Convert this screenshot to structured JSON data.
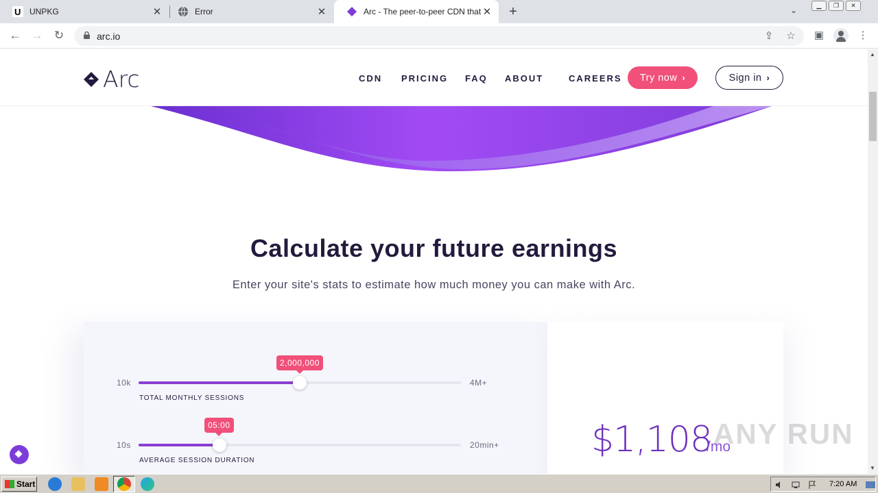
{
  "browser": {
    "tabs": [
      {
        "title": "UNPKG"
      },
      {
        "title": "Error"
      },
      {
        "title": "Arc - The peer-to-peer CDN that pays"
      }
    ],
    "url": "arc.io"
  },
  "site": {
    "logo_text": "Arc",
    "nav": [
      "CDN",
      "PRICING",
      "FAQ",
      "ABOUT",
      "CAREERS"
    ],
    "try_label": "Try now",
    "sign_label": "Sign in",
    "headline": "Calculate your future earnings",
    "subhead": "Enter your site's stats to estimate how much money you can make with Arc.",
    "sliders": [
      {
        "min": "10k",
        "max": "4M+",
        "value": "2,000,000",
        "label": "TOTAL MONTHLY SESSIONS",
        "fraction": 0.5
      },
      {
        "min": "10s",
        "max": "20min+",
        "value": "05:00",
        "label": "AVERAGE SESSION DURATION",
        "fraction": 0.25
      }
    ],
    "earnings": "$1,108",
    "earnings_unit": "/mo",
    "accent": "#f0507a",
    "brand": "#241a3d",
    "purple": "#8a3fd1"
  },
  "watermark": "ANY RUN",
  "taskbar": {
    "start_label": "Start",
    "clock": "7:20 AM"
  }
}
